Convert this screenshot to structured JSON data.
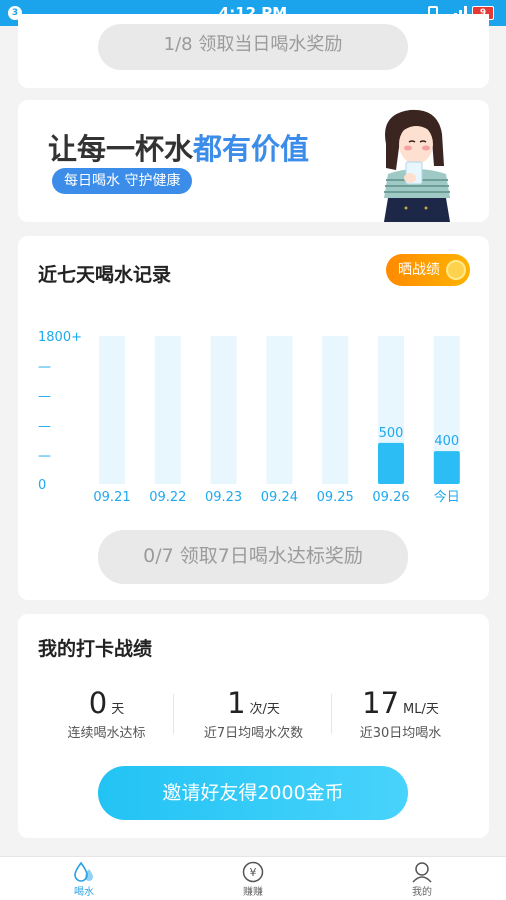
{
  "status_bar": {
    "notification_count": "3",
    "time": "4:12 PM",
    "battery": "9"
  },
  "reward_top": {
    "label": "1/8 领取当日喝水奖励"
  },
  "banner": {
    "slogan_part1": "让每一杯水",
    "slogan_part2": "都有价值",
    "tag": "每日喝水 守护健康"
  },
  "record": {
    "title": "近七天喝水记录",
    "share_label": "晒战绩",
    "claim_label": "0/7 领取7日喝水达标奖励"
  },
  "chart_data": {
    "type": "bar",
    "categories": [
      "09.21",
      "09.22",
      "09.23",
      "09.24",
      "09.25",
      "09.26",
      "今日"
    ],
    "values": [
      0,
      0,
      0,
      0,
      0,
      500,
      400
    ],
    "value_labels": [
      "",
      "",
      "",
      "",
      "",
      "500",
      "400"
    ],
    "y_ticks": [
      "0",
      "—",
      "—",
      "—",
      "—",
      "1800+"
    ],
    "ylim": [
      0,
      1800
    ],
    "colors": {
      "bar": "#2bbdf3",
      "track": "#e8f6fe",
      "label": "#1ea9ef"
    }
  },
  "stats": {
    "title": "我的打卡战绩",
    "items": [
      {
        "value": "0",
        "unit": "天",
        "label": "连续喝水达标"
      },
      {
        "value": "1",
        "unit": "次/天",
        "label": "近7日均喝水次数"
      },
      {
        "value": "17",
        "unit": "ML/天",
        "label": "近30日均喝水"
      }
    ],
    "invite_label": "邀请好友得2000金币"
  },
  "nav": [
    {
      "label": "喝水",
      "icon": "water-drop-icon",
      "active": true
    },
    {
      "label": "赚赚",
      "icon": "coin-yuan-icon",
      "active": false
    },
    {
      "label": "我的",
      "icon": "user-icon",
      "active": false
    }
  ]
}
